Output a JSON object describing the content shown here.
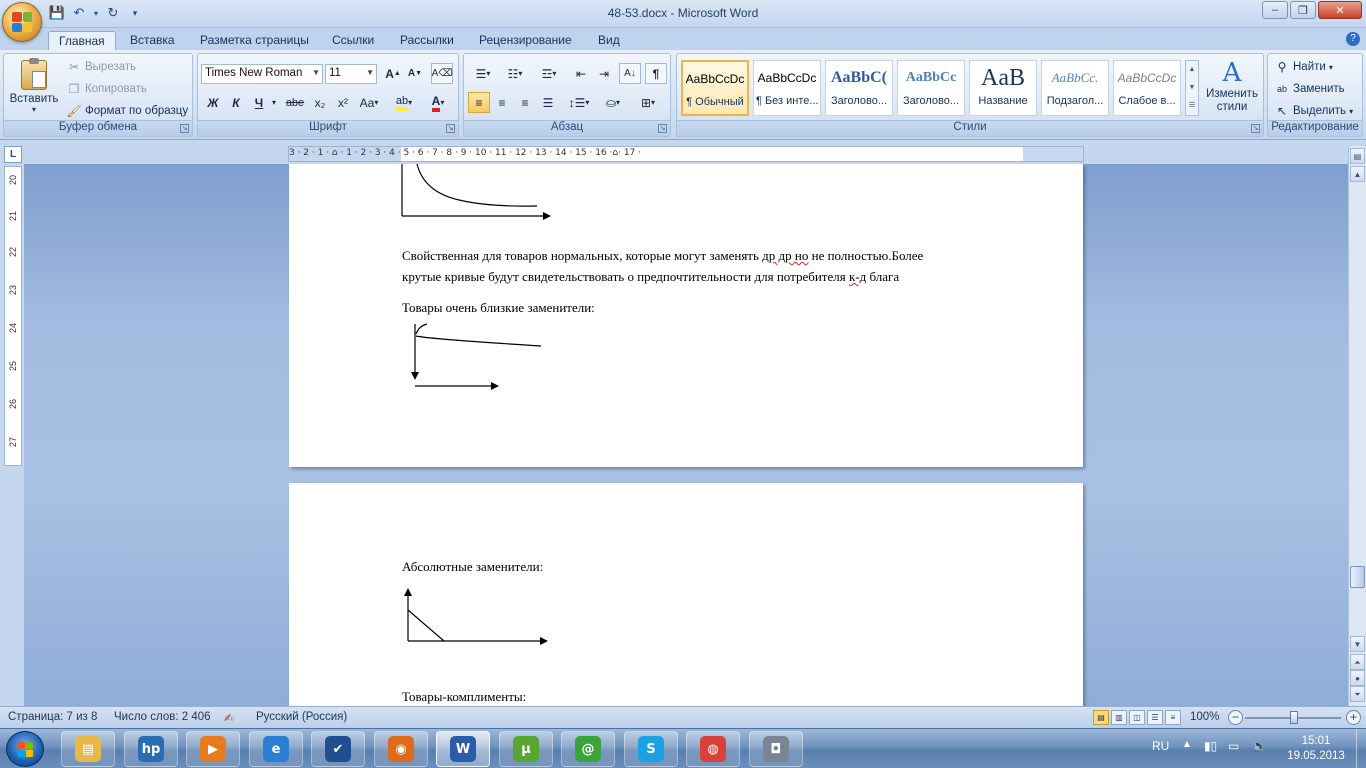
{
  "window": {
    "title": "48-53.docx - Microsoft Word",
    "minimize": "–",
    "restore": "❐",
    "close": "✕"
  },
  "ribbon_tabs": [
    "Главная",
    "Вставка",
    "Разметка страницы",
    "Ссылки",
    "Рассылки",
    "Рецензирование",
    "Вид"
  ],
  "clipboard": {
    "paste": "Вставить",
    "cut": "Вырезать",
    "copy": "Копировать",
    "format_painter": "Формат по образцу",
    "label": "Буфер обмена"
  },
  "font": {
    "family": "Times New Roman",
    "size": "11",
    "label": "Шрифт",
    "bold": "Ж",
    "italic": "К",
    "underline": "Ч",
    "strike": "abe",
    "subscript": "x₂",
    "superscript": "x²",
    "case": "Aa"
  },
  "paragraph": {
    "label": "Абзац"
  },
  "styles": {
    "label": "Стили",
    "items": [
      {
        "sample": "AaBbCcDc",
        "name": "¶ Обычный"
      },
      {
        "sample": "AaBbCcDc",
        "name": "¶ Без инте..."
      },
      {
        "sample": "AaBbC(",
        "name": "Заголово..."
      },
      {
        "sample": "AaBbCc",
        "name": "Заголово..."
      },
      {
        "sample": "AaB",
        "name": "Название"
      },
      {
        "sample": "AaBbCc.",
        "name": "Подзагол..."
      },
      {
        "sample": "AaBbCcDc",
        "name": "Слабое в..."
      }
    ],
    "change_styles": "Изменить стили"
  },
  "editing": {
    "label": "Редактирование",
    "find": "Найти",
    "replace": "Заменить",
    "select": "Выделить"
  },
  "ruler": {
    "corner": "L",
    "h_numbers": "3 · 2 · 1 · ⌂ · 1 · 2 · 3 · 4 · 5 · 6 · 7 · 8 · 9 · 10 · 11 · 12 · 13 · 14 · 15 · 16 ·⌂· 17 ·",
    "v_numbers": [
      "20",
      "21",
      "22",
      "23",
      "24",
      "25",
      "26",
      "27"
    ]
  },
  "document": {
    "page1": {
      "para1_line1_a": "Свойственная для товаров нормальных, которые могут заменять ",
      "para1_squig1": "др др но",
      "para1_line1_b": " не полностью.Более",
      "para1_line2_a": "крутые кривые будут свидетельствовать о предпочтительности для потребителя ",
      "para1_squig2": "к-д",
      "para1_line2_b": " блага",
      "para2": "Товары очень близкие заменители:"
    },
    "page2": {
      "para1": "Абсолютные заменители:",
      "para2": "Товары-комплименты:"
    }
  },
  "status": {
    "page": "Страница: 7 из 8",
    "words": "Число слов: 2 406",
    "language": "Русский (Россия)",
    "zoom": "100%",
    "zoom_minus": "−",
    "zoom_plus": "+"
  },
  "taskbar": {
    "lang": "RU",
    "time": "15:01",
    "date": "19.05.2013",
    "apps": [
      {
        "name": "explorer",
        "color": "#e8b74a",
        "glyph": "▤"
      },
      {
        "name": "hp",
        "color": "#2a6db5",
        "glyph": "hp"
      },
      {
        "name": "media-player",
        "color": "#e87b1e",
        "glyph": "▶"
      },
      {
        "name": "internet-explorer",
        "color": "#2b7fd4",
        "glyph": "e"
      },
      {
        "name": "task-app",
        "color": "#1f4f8f",
        "glyph": "✔"
      },
      {
        "name": "firefox",
        "color": "#e06a1b",
        "glyph": "◉"
      },
      {
        "name": "word",
        "color": "#2a5caa",
        "glyph": "W"
      },
      {
        "name": "utorrent",
        "color": "#56a630",
        "glyph": "µ"
      },
      {
        "name": "mail-agent",
        "color": "#3aa33a",
        "glyph": "@"
      },
      {
        "name": "skype",
        "color": "#1ba1e2",
        "glyph": "S"
      },
      {
        "name": "chrome",
        "color": "#d9423a",
        "glyph": "◍"
      },
      {
        "name": "camera-app",
        "color": "#7c8594",
        "glyph": "◘"
      }
    ]
  }
}
